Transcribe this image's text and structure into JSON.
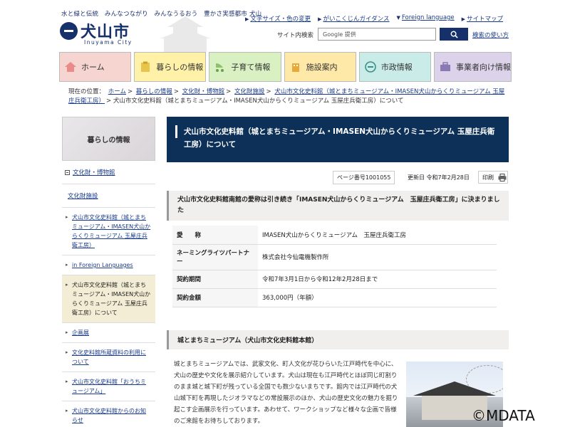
{
  "header": {
    "tagline": "水と緑と伝統　みんなつながり　みんなうるおう　豊かさ実感都市 犬山",
    "logo_text": "犬山市",
    "logo_sub": "Inuyama City",
    "top_links": [
      "文字サイズ・色の変更",
      "がいこくじんガイダンス",
      "Foreign language",
      "サイトマップ"
    ],
    "search_label": "サイト内検索",
    "search_placeholder": "Google 提供",
    "search_help": "検索の使い方"
  },
  "nav": {
    "items": [
      {
        "label": "ホーム",
        "color": "#f6d4d0"
      },
      {
        "label": "暮らしの情報",
        "color": "#fff2a8"
      },
      {
        "label": "子育て情報",
        "color": "#d9f0c2"
      },
      {
        "label": "施設案内",
        "color": "#ffe9a8"
      },
      {
        "label": "市政情報",
        "color": "#c9ece8"
      },
      {
        "label": "事業者向け情報",
        "color": "#dcd3ea"
      }
    ]
  },
  "breadcrumb": {
    "prefix": "現在の位置：",
    "links": [
      "ホーム",
      "暮らしの情報",
      "文化財・博物館",
      "文化財施設",
      "犬山市文化史料館（城とまちミュージアム・IMASEN犬山からくりミュージアム 玉屋庄兵衛工房）"
    ],
    "current": "犬山市文化史料館（城とまちミュージアム・IMASEN犬山からくりミュージアム 玉屋庄兵衛工房）について"
  },
  "sidebar": {
    "title": "暮らしの情報",
    "section": "文化財・博物館",
    "sub": "文化財施設",
    "items": [
      "犬山市文化史料館（城とまちミュージアム・IMASEN犬山からくりミュージアム 玉屋庄兵衛工房）",
      "in Foreign Languages",
      "犬山市文化史料館（城とまちミュージアム・IMASEN犬山からくりミュージアム 玉屋庄兵衛工房）について",
      "企画展",
      "文化史料館所蔵資料の利用について",
      "犬山市文化史料館「おうちミュージアム」",
      "犬山市文化史料館からのお知らせ"
    ]
  },
  "main": {
    "title": "犬山市文化史料館（城とまちミュージアム・IMASEN犬山からくりミュージアム 玉屋庄兵衛工房）について",
    "page_no": "ページ番号1001055",
    "updated": "更新日 令和7年2月28日",
    "print": "印刷",
    "headline": "犬山市文化史料館南館の愛称は引き続き「IMASEN犬山からくりミュージアム　玉屋庄兵衛工房」に決まりました",
    "table": [
      {
        "k": "愛　　称",
        "v": "IMASEN犬山からくりミュージアム　玉屋庄兵衛工房"
      },
      {
        "k": "ネーミングライツパートナー",
        "v": "株式会社今仙電機製作所"
      },
      {
        "k": "契約期間",
        "v": "令和7年3月1日から令和12年2月28日まで"
      },
      {
        "k": "契約金額",
        "v": "363,000円（年額）"
      }
    ],
    "section_title": "城とまちミュージアム（犬山市文化史料館本館）",
    "body": "城とまちミュージアムでは、武家文化、町人文化が花ひらいた江戸時代を中心に、犬山の歴史や文化を展示紹介しています。犬山は現在も江戸時代とほぼ同じ町割りのまま城と城下町が残っている全国でも数少ないまちです。館内では江戸時代の犬山城下町を再現したジオラマなどの常設展示のほか、犬山の歴史文化の魅力を掘り起こす企画展示を行っています。あわせて、ワークショップなど様々な企画で皆様のご来館をお待ちしております。"
  },
  "watermark": "©MDATA"
}
